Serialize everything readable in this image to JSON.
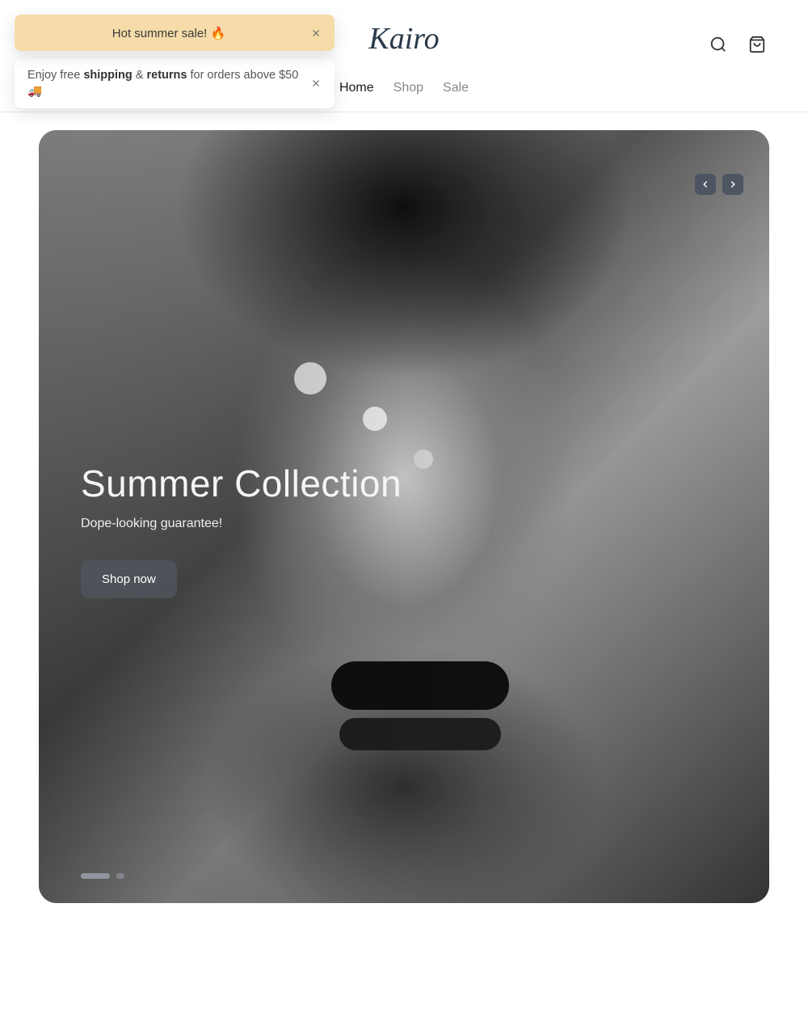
{
  "toasts": [
    {
      "text": "Hot summer sale! 🔥"
    },
    {
      "prefix": "Enjoy free ",
      "bold1": "shipping",
      "middle": " & ",
      "bold2": "returns",
      "suffix": " for orders above $50 🚚"
    }
  ],
  "brand": "Kairo",
  "nav": {
    "items": [
      {
        "label": "Home",
        "active": true
      },
      {
        "label": "Shop",
        "active": false
      },
      {
        "label": "Sale",
        "active": false
      }
    ]
  },
  "hero": {
    "title": "Summer Collection",
    "subtitle": "Dope-looking guarantee!",
    "cta": "Shop now"
  }
}
